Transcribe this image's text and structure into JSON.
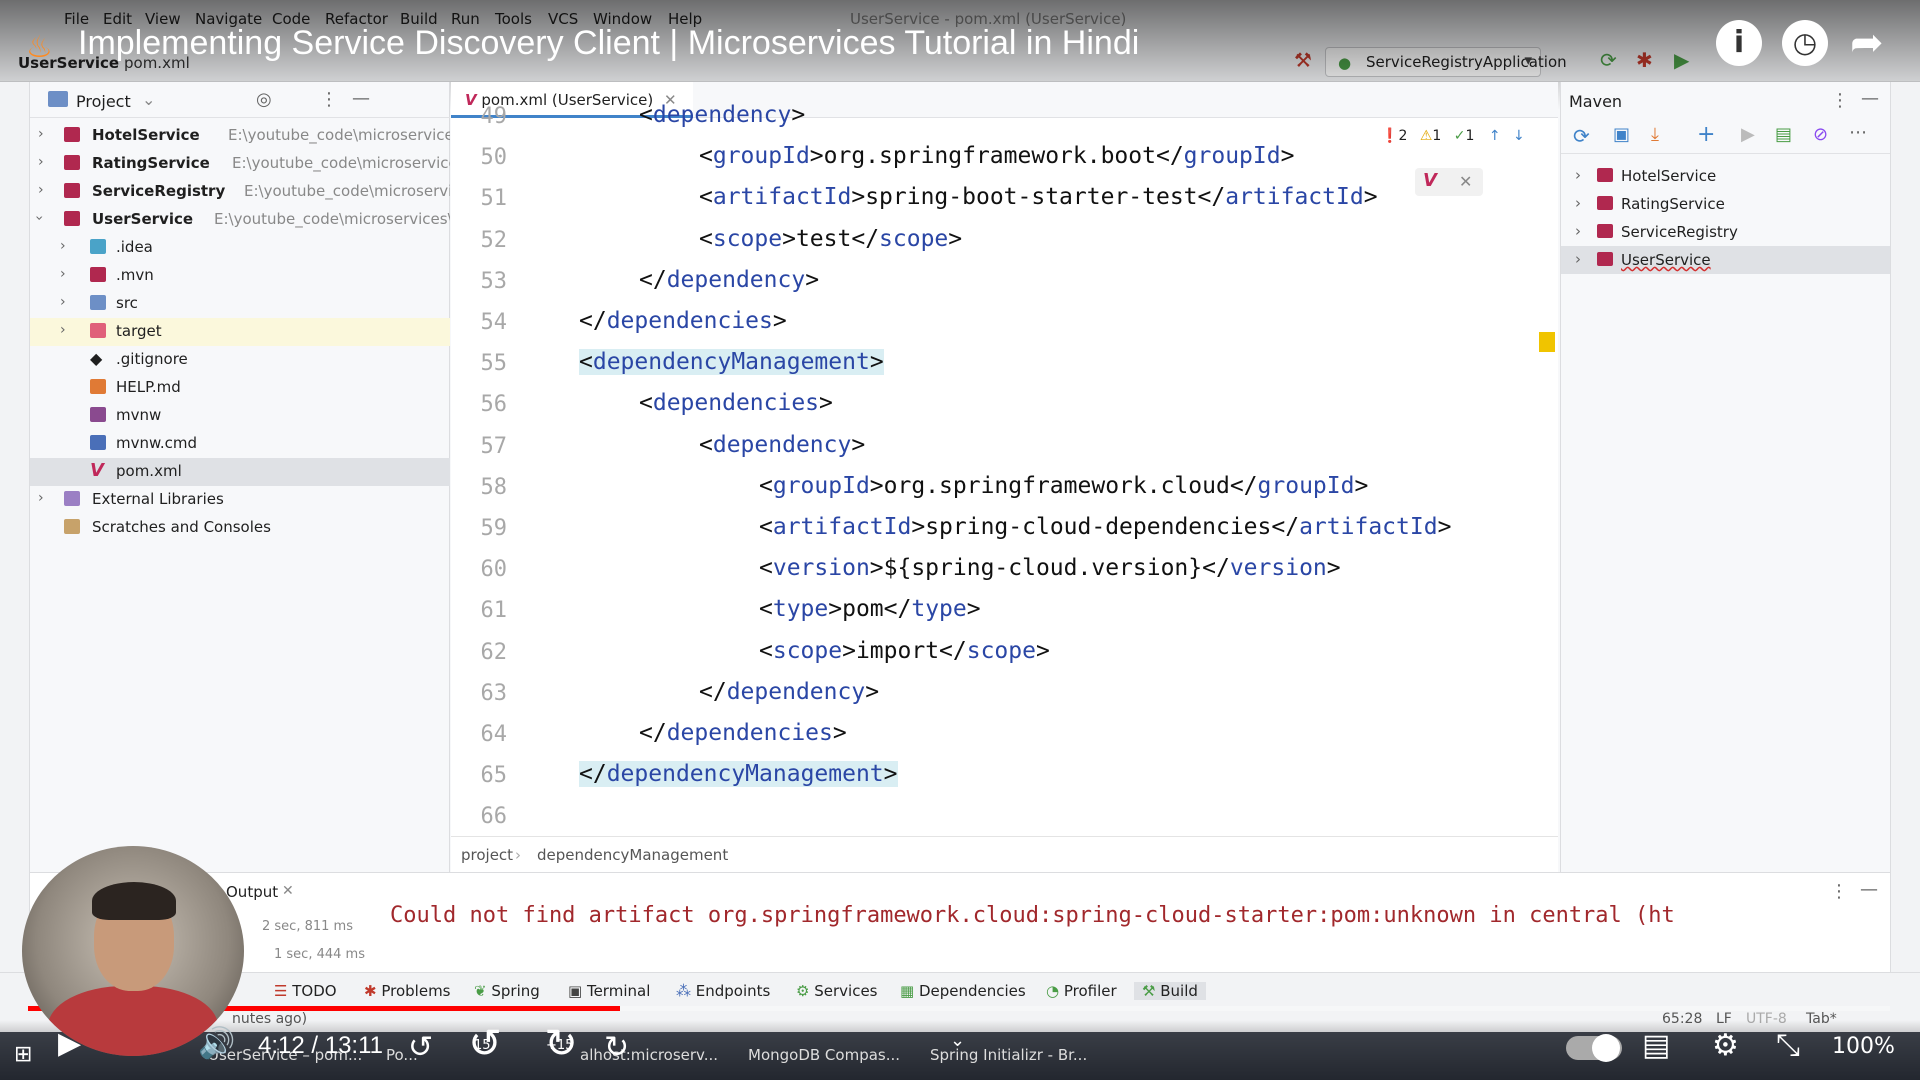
{
  "menu": [
    "File",
    "Edit",
    "View",
    "Navigate",
    "Code",
    "Refactor",
    "Build",
    "Run",
    "Tools",
    "VCS",
    "Window",
    "Help"
  ],
  "window_title": "UserService - pom.xml (UserService)",
  "toolbar": {
    "project": "UserService",
    "file": "pom.xml",
    "run_config": "ServiceRegistryApplication"
  },
  "video": {
    "title": "Implementing Service Discovery Client | Microservices Tutorial in Hindi",
    "time": "4:12 / 13:11",
    "progress_fraction": 0.318,
    "zoom": "100%",
    "back": "15",
    "fwd": "+15"
  },
  "project_panel": {
    "title": "Project",
    "items": [
      {
        "label": "HotelService",
        "path": "E:\\youtube_code\\microservices\\HotelSe",
        "bold": true
      },
      {
        "label": "RatingService",
        "path": "E:\\youtube_code\\microservices\\Rating",
        "bold": true
      },
      {
        "label": "ServiceRegistry",
        "path": "E:\\youtube_code\\microservices\\Servi",
        "bold": true
      },
      {
        "label": "UserService",
        "path": "E:\\youtube_code\\microservices\\UserServ",
        "bold": true
      },
      {
        "label": ".idea"
      },
      {
        "label": ".mvn"
      },
      {
        "label": "src"
      },
      {
        "label": "target"
      },
      {
        "label": ".gitignore"
      },
      {
        "label": "HELP.md"
      },
      {
        "label": "mvnw"
      },
      {
        "label": "mvnw.cmd"
      },
      {
        "label": "pom.xml"
      },
      {
        "label": "External Libraries"
      },
      {
        "label": "Scratches and Consoles"
      }
    ]
  },
  "editor": {
    "tab": "pom.xml (UserService)",
    "inspections": {
      "errors": "2",
      "warnings": "1",
      "typos": "1"
    },
    "lines": [
      {
        "n": "49",
        "code": "<dependency>"
      },
      {
        "n": "50",
        "code": "<groupId>org.springframework.boot</groupId>"
      },
      {
        "n": "51",
        "code": "<artifactId>spring-boot-starter-test</artifactId>"
      },
      {
        "n": "52",
        "code": "<scope>test</scope>"
      },
      {
        "n": "53",
        "code": "</dependency>"
      },
      {
        "n": "54",
        "code": "</dependencies>"
      },
      {
        "n": "55",
        "code": "<dependencyManagement>"
      },
      {
        "n": "56",
        "code": "<dependencies>"
      },
      {
        "n": "57",
        "code": "<dependency>"
      },
      {
        "n": "58",
        "code": "<groupId>org.springframework.cloud</groupId>"
      },
      {
        "n": "59",
        "code": "<artifactId>spring-cloud-dependencies</artifactId>"
      },
      {
        "n": "60",
        "code": "<version>${spring-cloud.version}</version>"
      },
      {
        "n": "61",
        "code": "<type>pom</type>"
      },
      {
        "n": "62",
        "code": "<scope>import</scope>"
      },
      {
        "n": "63",
        "code": "</dependency>"
      },
      {
        "n": "64",
        "code": "</dependencies>"
      },
      {
        "n": "65",
        "code": "</dependencyManagement>"
      },
      {
        "n": "66",
        "code": ""
      }
    ],
    "breadcrumb": [
      "project",
      "dependencyManagement"
    ]
  },
  "maven": {
    "title": "Maven",
    "projects": [
      "HotelService",
      "RatingService",
      "ServiceRegistry",
      "UserService"
    ]
  },
  "build_output": {
    "tab": "Output",
    "error": "Could not find artifact org.springframework.cloud:spring-cloud-starter:pom:unknown in central (ht",
    "timings": [
      "2 sec, 811 ms",
      "1 sec, 444 ms"
    ]
  },
  "tool_windows": [
    "TODO",
    "Problems",
    "Spring",
    "Terminal",
    "Endpoints",
    "Services",
    "Dependencies",
    "Profiler",
    "Build"
  ],
  "status": {
    "message": "nutes ago)",
    "position": "65:28",
    "line_sep": "LF",
    "encoding": "UTF-8",
    "indent": "Tab*"
  },
  "taskbar": [
    "UserService – pom...",
    "Po...",
    "alhost:microserv...",
    "MongoDB Compas...",
    "Spring Initializr - Br..."
  ],
  "colors": {
    "accent": "#4083c9",
    "tag": "#2a46a5",
    "error": "#a1282c",
    "highlight": "#d9eef3",
    "yt_red": "#ff0000"
  }
}
